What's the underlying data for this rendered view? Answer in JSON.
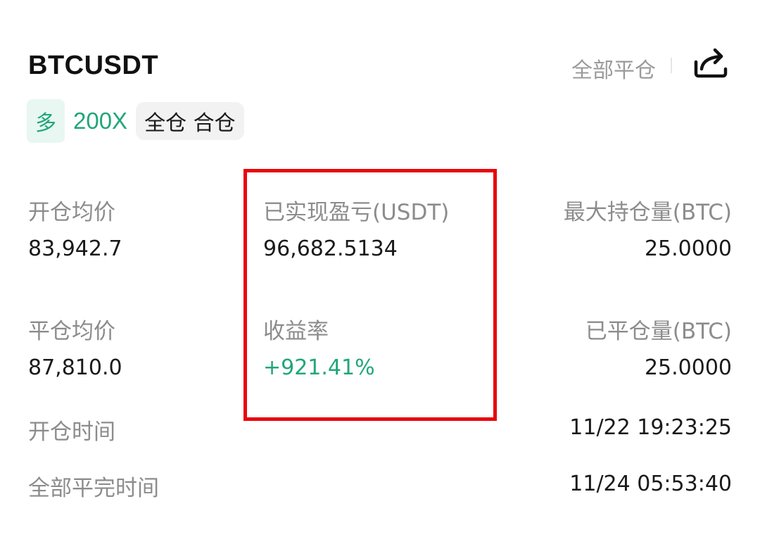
{
  "header": {
    "symbol": "BTCUSDT",
    "close_all_label": "全部平仓",
    "share_icon": "share-icon"
  },
  "tags": {
    "direction": "多",
    "leverage": "200X",
    "margin_mode": "全仓 合仓"
  },
  "stats": {
    "open_avg_price_label": "开仓均价",
    "open_avg_price_value": "83,942.7",
    "realized_pnl_label": "已实现盈亏(USDT)",
    "realized_pnl_value": "96,682.5134",
    "max_position_label": "最大持仓量(BTC)",
    "max_position_value": "25.0000",
    "close_avg_price_label": "平仓均价",
    "close_avg_price_value": "87,810.0",
    "return_rate_label": "收益率",
    "return_rate_value": "+921.41%",
    "closed_qty_label": "已平仓量(BTC)",
    "closed_qty_value": "25.0000",
    "open_time_label": "开仓时间",
    "open_time_value": "11/22 19:23:25",
    "full_close_time_label": "全部平完时间",
    "full_close_time_value": "11/24 05:53:40"
  },
  "colors": {
    "positive": "#21a67a",
    "highlight": "#e8060c",
    "label_gray": "#8c8c8c"
  }
}
